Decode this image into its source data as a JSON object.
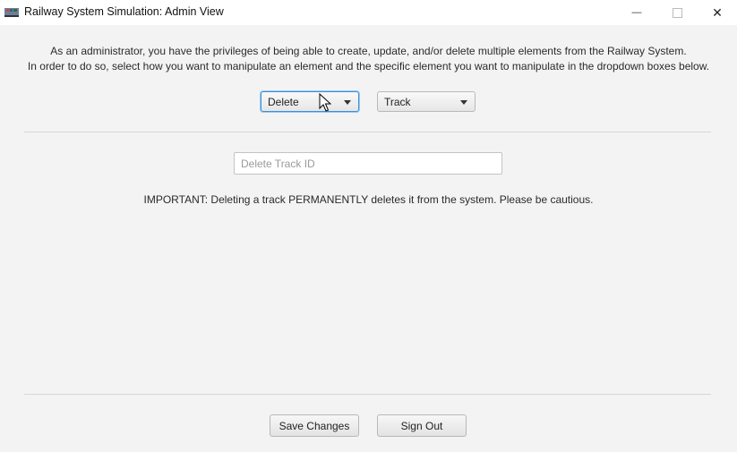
{
  "window": {
    "title": "Railway System Simulation: Admin View",
    "controls": {
      "minimize_icon": "minimize-icon",
      "maximize_icon": "maximize-icon",
      "close_icon": "close-icon",
      "minimize_glyph": "—",
      "close_glyph": "✕"
    }
  },
  "intro": {
    "line1": "As an administrator, you have the privileges of being able to create, update, and/or delete multiple elements from the Railway System.",
    "line2": "In order to do so, select how you want to manipulate an element and the specific element you want to manipulate in the dropdown boxes below."
  },
  "controls": {
    "action_selected": "Delete",
    "element_selected": "Track"
  },
  "form": {
    "track_id_value": "",
    "track_id_placeholder": "Delete Track ID",
    "warning": "IMPORTANT: Deleting a track PERMANENTLY deletes it from the system. Please be cautious."
  },
  "footer": {
    "save_label": "Save Changes",
    "signout_label": "Sign Out"
  },
  "colors": {
    "focus_border": "#3c8fd6",
    "background": "#f3f3f3"
  }
}
